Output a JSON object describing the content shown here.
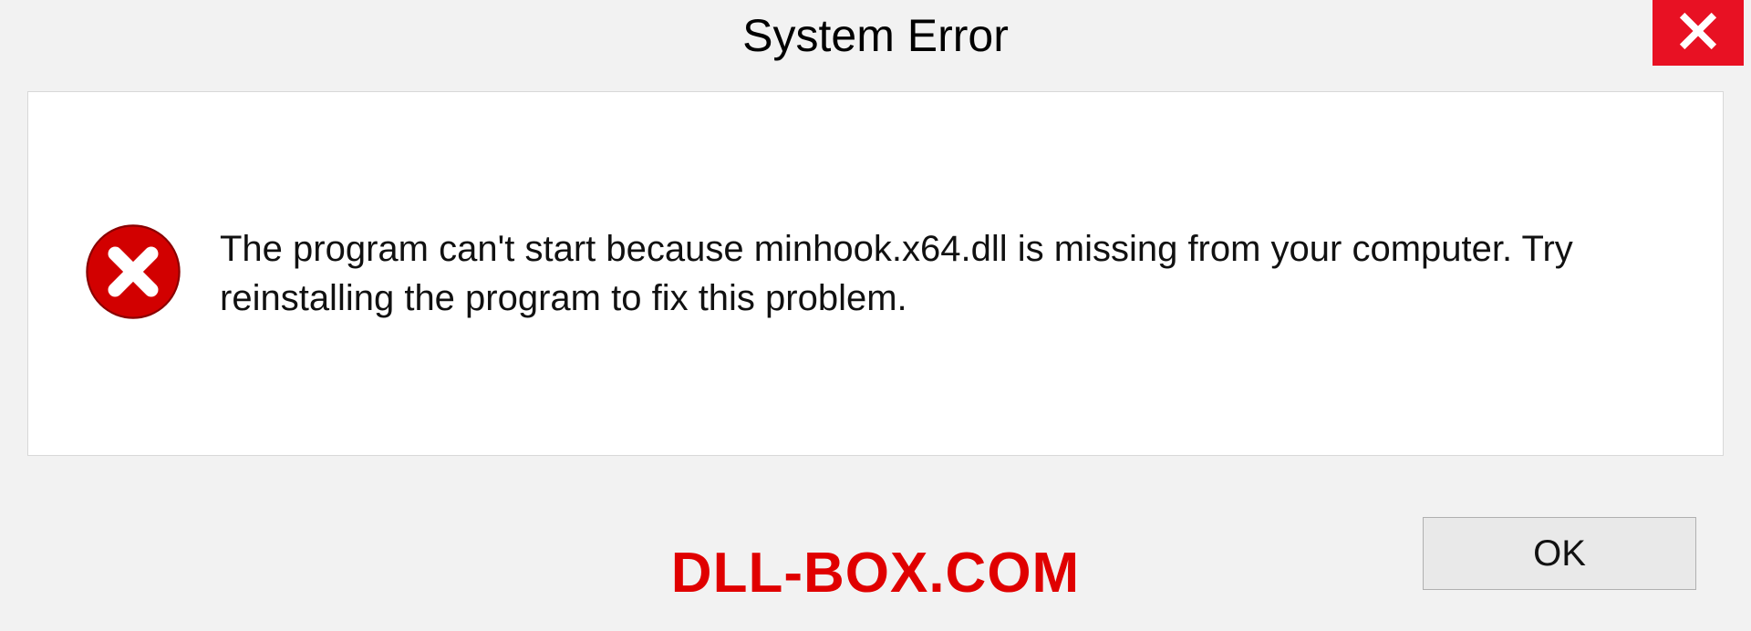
{
  "dialog": {
    "title": "System Error",
    "message": "The program can't start because minhook.x64.dll is missing from your computer. Try reinstalling the program to fix this problem.",
    "ok_label": "OK"
  },
  "watermark": {
    "text": "DLL-BOX.COM"
  },
  "colors": {
    "close_bg": "#e81123",
    "error_red": "#d20000",
    "watermark_red": "#e00000"
  }
}
